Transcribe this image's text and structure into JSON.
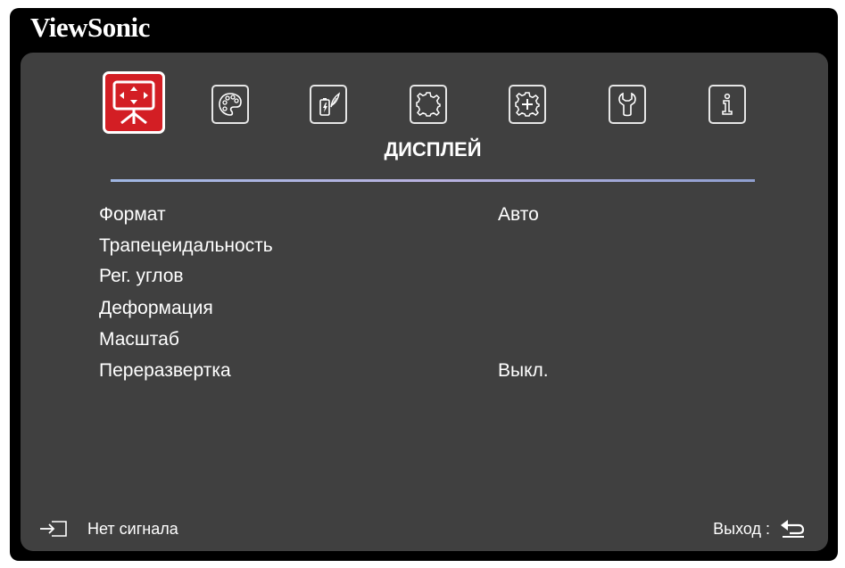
{
  "brand": "ViewSonic",
  "tabs": [
    {
      "id": "display",
      "icon": "display-icon",
      "active": true
    },
    {
      "id": "picture",
      "icon": "palette-icon",
      "active": false
    },
    {
      "id": "power",
      "icon": "power-management-icon",
      "active": false
    },
    {
      "id": "basic",
      "icon": "basic-settings-icon",
      "active": false
    },
    {
      "id": "advanced",
      "icon": "advanced-settings-icon",
      "active": false
    },
    {
      "id": "system",
      "icon": "wrench-icon",
      "active": false
    },
    {
      "id": "information",
      "icon": "info-icon",
      "active": false
    }
  ],
  "section_title": "ДИСПЛЕЙ",
  "menu": [
    {
      "label": "Формат",
      "value": "Авто"
    },
    {
      "label": "Трапецеидальность",
      "value": ""
    },
    {
      "label": "Рег. углов",
      "value": ""
    },
    {
      "label": "Деформация",
      "value": ""
    },
    {
      "label": "Масштаб",
      "value": ""
    },
    {
      "label": "Переразвертка",
      "value": "Выкл."
    }
  ],
  "footer": {
    "input_status": "Нет сигнала",
    "exit_label": "Выход :"
  },
  "colors": {
    "frame": "#000000",
    "panel": "#404040",
    "active_tab": "#d31e24",
    "text": "#ffffff"
  }
}
